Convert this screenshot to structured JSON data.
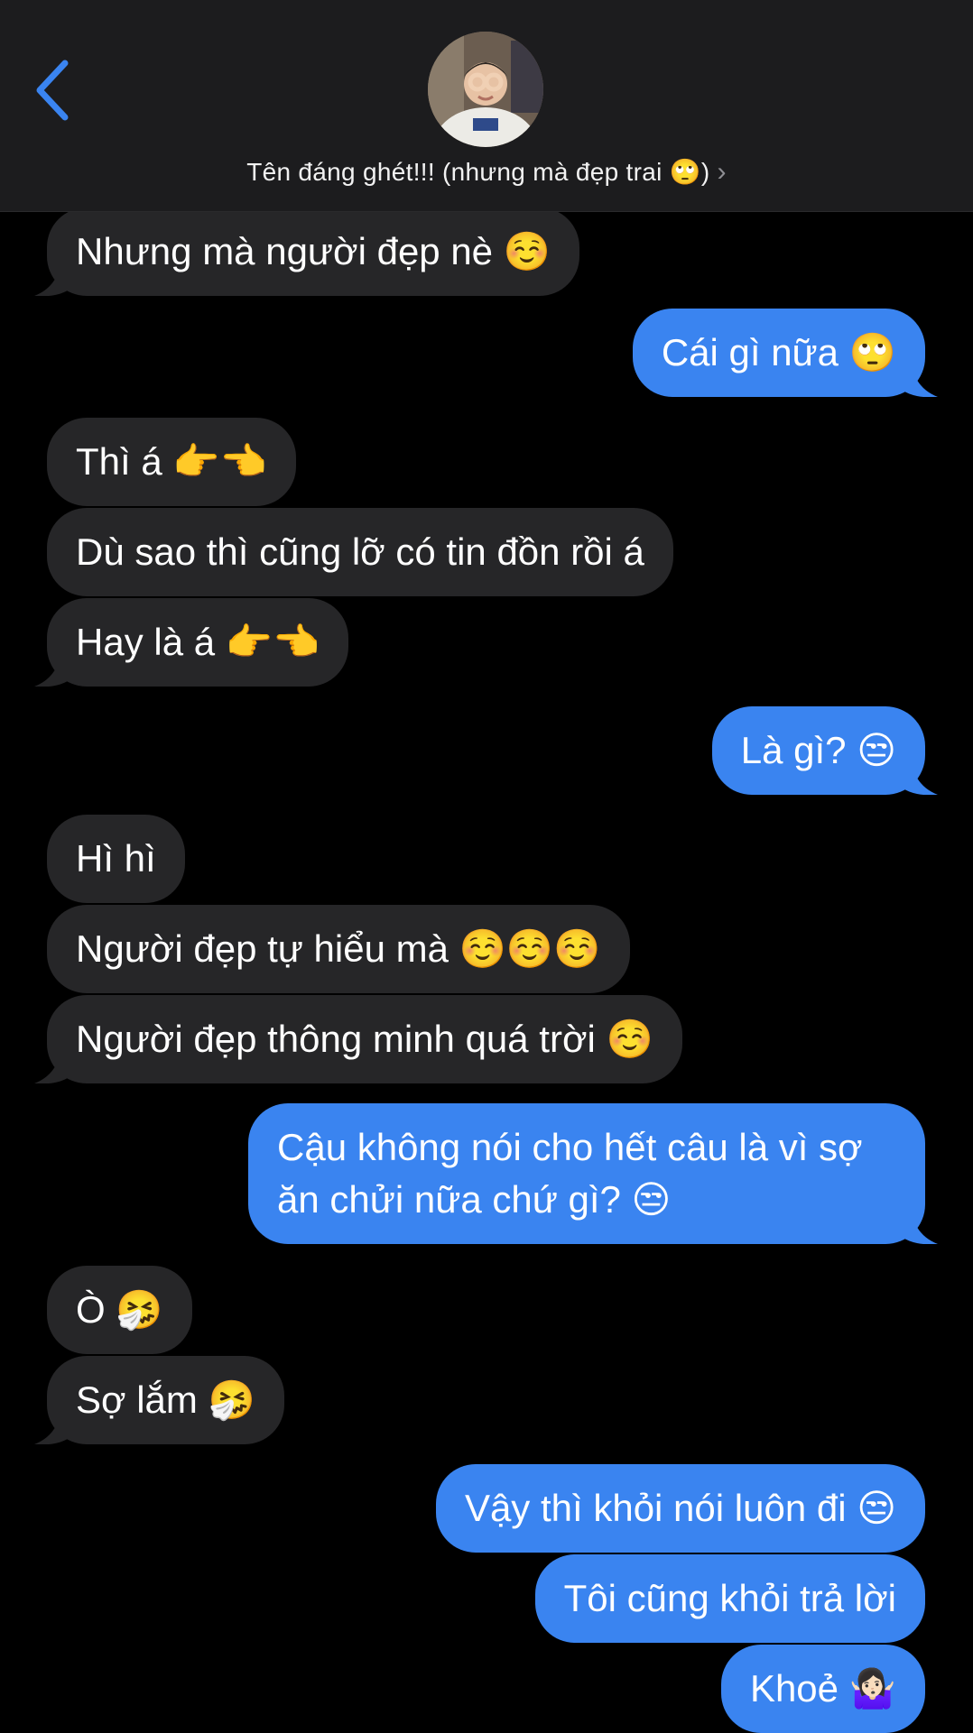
{
  "header": {
    "back_icon": "chevron-left-icon",
    "contact_name": "Tên đáng ghét!!! (nhưng mà đẹp trai 🙄)",
    "chevron": "›",
    "avatar_icon": "contact-avatar-photo",
    "accent_color": "#3a84f0"
  },
  "messages": [
    {
      "side": "recv",
      "text": "Nhưng mà người đẹp nè ☺️",
      "tail": true
    },
    {
      "side": "sent",
      "text": "Cái gì nữa 🙄",
      "tail": true
    },
    {
      "side": "recv",
      "text": "Thì á 👉👈",
      "tail": false
    },
    {
      "side": "recv",
      "text": "Dù sao thì cũng lỡ có tin đồn rồi á",
      "tail": false
    },
    {
      "side": "recv",
      "text": "Hay là á 👉👈",
      "tail": true
    },
    {
      "side": "sent",
      "text": "Là gì? 😒",
      "tail": true
    },
    {
      "side": "recv",
      "text": "Hì hì",
      "tail": false
    },
    {
      "side": "recv",
      "text": "Người đẹp tự hiểu mà ☺️☺️☺️",
      "tail": false
    },
    {
      "side": "recv",
      "text": "Người đẹp thông minh quá trời ☺️",
      "tail": true
    },
    {
      "side": "sent",
      "text": "Cậu không nói cho hết câu là vì sợ ăn chửi nữa chứ gì? 😒",
      "tail": true
    },
    {
      "side": "recv",
      "text": "Ò 🤧",
      "tail": false
    },
    {
      "side": "recv",
      "text": "Sợ lắm 🤧",
      "tail": true
    },
    {
      "side": "sent",
      "text": "Vậy thì khỏi nói luôn đi 😒",
      "tail": false
    },
    {
      "side": "sent",
      "text": "Tôi cũng khỏi trả lời",
      "tail": false
    },
    {
      "side": "sent",
      "text": "Khoẻ 🤷🏻‍♀️",
      "tail": false
    }
  ]
}
